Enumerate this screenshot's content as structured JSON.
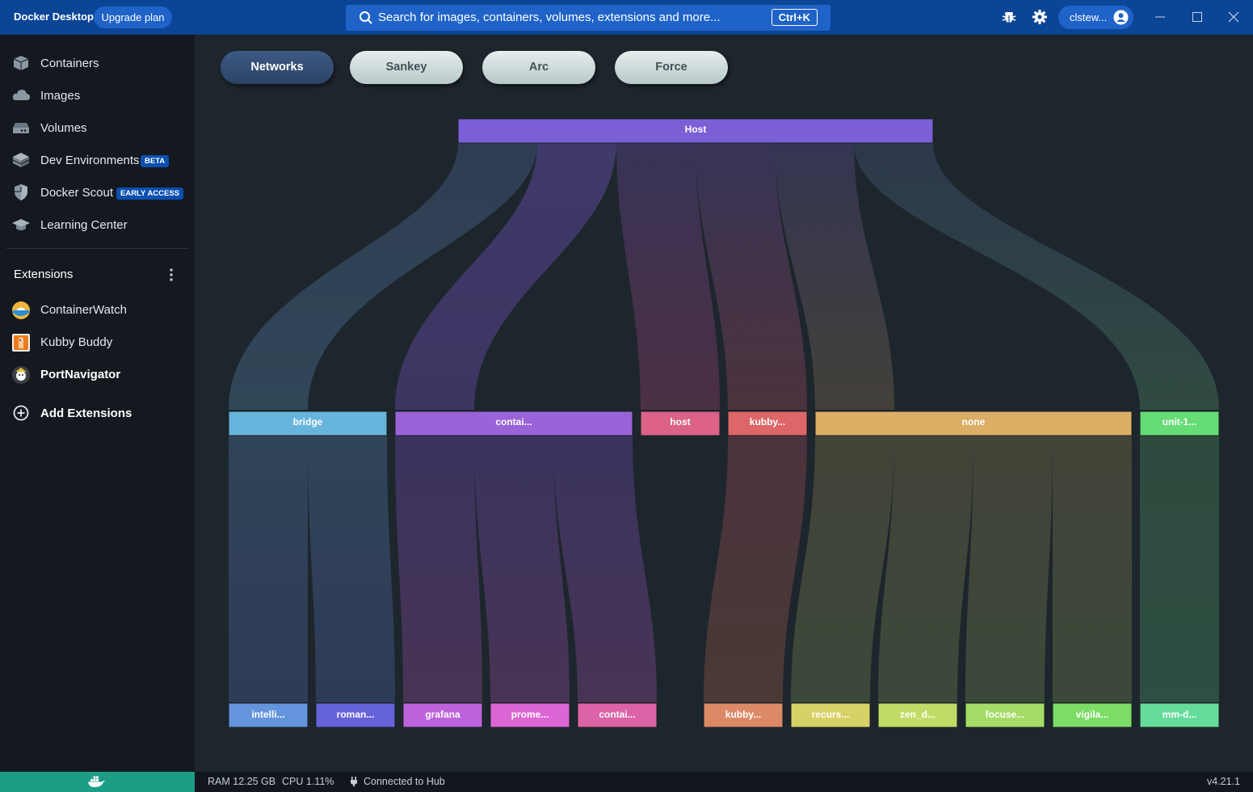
{
  "titlebar": {
    "app_name": "Docker Desktop",
    "upgrade_label": "Upgrade plan",
    "search_placeholder": "Search for images, containers, volumes, extensions and more...",
    "search_shortcut": "Ctrl+K",
    "account_name": "clstew..."
  },
  "sidebar": {
    "items": [
      {
        "label": "Containers",
        "icon": "containers-icon"
      },
      {
        "label": "Images",
        "icon": "images-cloud-icon"
      },
      {
        "label": "Volumes",
        "icon": "volumes-drive-icon"
      },
      {
        "label": "Dev Environments",
        "icon": "dev-environments-icon",
        "badge": "BETA"
      },
      {
        "label": "Docker Scout",
        "icon": "docker-scout-shield-icon",
        "badge": "EARLY ACCESS"
      },
      {
        "label": "Learning Center",
        "icon": "learning-center-cap-icon"
      }
    ],
    "extensions_title": "Extensions",
    "extensions": [
      {
        "label": "ContainerWatch",
        "icon": "containerwatch-icon"
      },
      {
        "label": "Kubby Buddy",
        "icon": "kubby-buddy-icon"
      },
      {
        "label": "PortNavigator",
        "icon": "portnavigator-icon"
      }
    ],
    "add_extensions_label": "Add Extensions"
  },
  "tabs": [
    {
      "label": "Networks",
      "active": true
    },
    {
      "label": "Sankey",
      "active": false
    },
    {
      "label": "Arc",
      "active": false
    },
    {
      "label": "Force",
      "active": false
    }
  ],
  "diagram": {
    "root": {
      "label": "Host",
      "color": "#7b5fd6"
    },
    "networks": [
      {
        "label": "bridge",
        "color": "#67b4dc"
      },
      {
        "label": "contai...",
        "color": "#9a63d8"
      },
      {
        "label": "host",
        "color": "#dc6288"
      },
      {
        "label": "kubby...",
        "color": "#dc6668"
      },
      {
        "label": "none",
        "color": "#dcae66"
      },
      {
        "label": "unit-1...",
        "color": "#66dc76"
      }
    ],
    "containers": [
      {
        "label": "intelli...",
        "color": "#6394dc",
        "network": "bridge"
      },
      {
        "label": "roman...",
        "color": "#6662d8",
        "network": "bridge"
      },
      {
        "label": "grafana",
        "color": "#bc63dc",
        "network": "contai..."
      },
      {
        "label": "prome...",
        "color": "#dc66d4",
        "network": "contai..."
      },
      {
        "label": "contai...",
        "color": "#dc63a6",
        "network": "contai..."
      },
      {
        "label": "kubby...",
        "color": "#dc8a66",
        "network": "kubby..."
      },
      {
        "label": "recurs...",
        "color": "#d8d166",
        "network": "none"
      },
      {
        "label": "zen_d...",
        "color": "#c1dc66",
        "network": "none"
      },
      {
        "label": "focuse...",
        "color": "#a4dc66",
        "network": "none"
      },
      {
        "label": "vigila...",
        "color": "#7bdc66",
        "network": "none"
      },
      {
        "label": "mm-d...",
        "color": "#66dc9a",
        "network": "unit-1..."
      }
    ]
  },
  "statusbar": {
    "ram": "RAM 12.25 GB",
    "cpu": "CPU 1.11%",
    "hub": "Connected to Hub",
    "version": "v4.21.1"
  }
}
